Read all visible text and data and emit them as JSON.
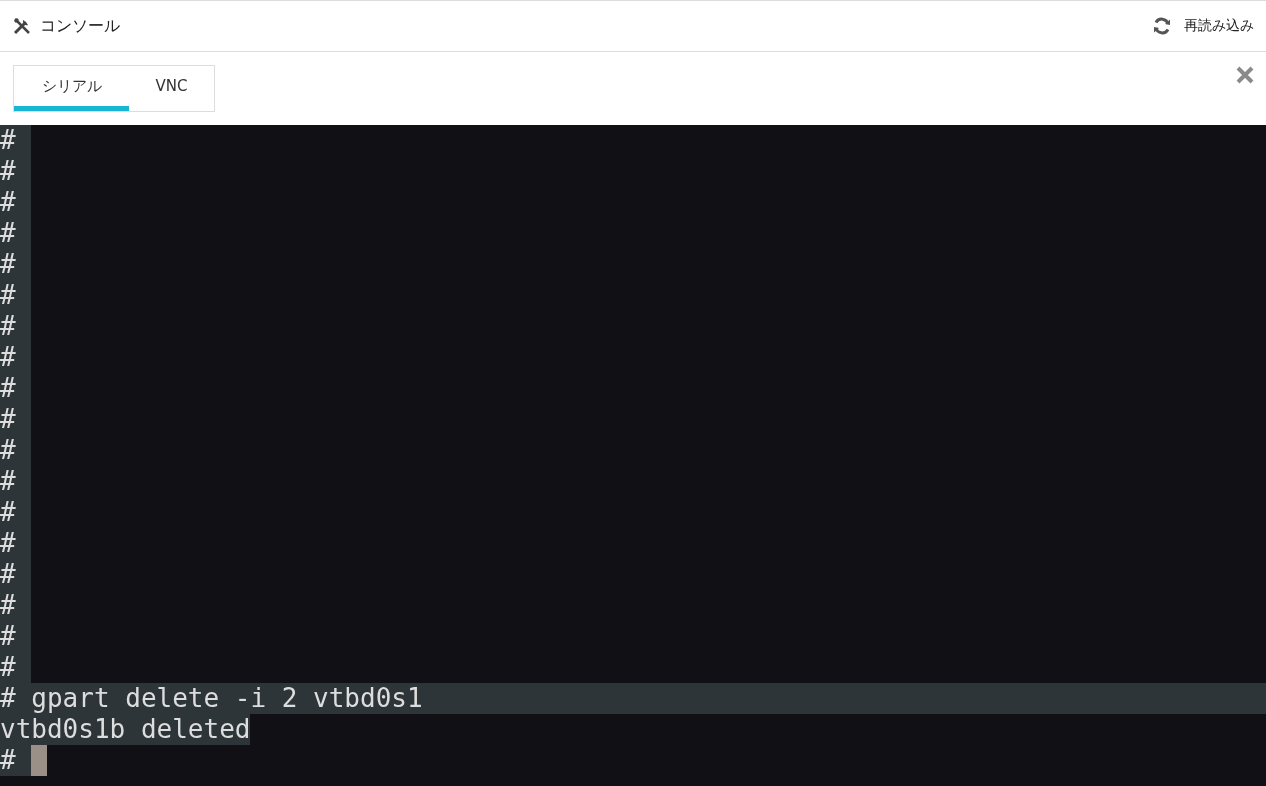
{
  "header": {
    "title": "コンソール",
    "reload": "再読み込み"
  },
  "tabs": [
    {
      "label": "シリアル",
      "selected": true
    },
    {
      "label": "VNC",
      "selected": false
    }
  ],
  "terminal": {
    "lines": [
      {
        "text": "# ",
        "kind": "text",
        "selected": true,
        "cursor": false
      },
      {
        "text": "# ",
        "kind": "text",
        "selected": true,
        "cursor": false
      },
      {
        "text": "# ",
        "kind": "text",
        "selected": true,
        "cursor": false
      },
      {
        "text": "# ",
        "kind": "text",
        "selected": true,
        "cursor": false
      },
      {
        "text": "# ",
        "kind": "text",
        "selected": true,
        "cursor": false
      },
      {
        "text": "# ",
        "kind": "text",
        "selected": true,
        "cursor": false
      },
      {
        "text": "# ",
        "kind": "text",
        "selected": true,
        "cursor": false
      },
      {
        "text": "# ",
        "kind": "text",
        "selected": true,
        "cursor": false
      },
      {
        "text": "# ",
        "kind": "text",
        "selected": true,
        "cursor": false
      },
      {
        "text": "# ",
        "kind": "text",
        "selected": true,
        "cursor": false
      },
      {
        "text": "# ",
        "kind": "text",
        "selected": true,
        "cursor": false
      },
      {
        "text": "# ",
        "kind": "text",
        "selected": true,
        "cursor": false
      },
      {
        "text": "# ",
        "kind": "text",
        "selected": true,
        "cursor": false
      },
      {
        "text": "# ",
        "kind": "text",
        "selected": true,
        "cursor": false
      },
      {
        "text": "# ",
        "kind": "text",
        "selected": true,
        "cursor": false
      },
      {
        "text": "# ",
        "kind": "text",
        "selected": true,
        "cursor": false
      },
      {
        "text": "# ",
        "kind": "text",
        "selected": true,
        "cursor": false
      },
      {
        "text": "# ",
        "kind": "text",
        "selected": true,
        "cursor": false
      },
      {
        "text": "# gpart delete -i 2 vtbd0s1",
        "kind": "row",
        "selected": true,
        "cursor": false
      },
      {
        "text": "vtbd0s1b deleted",
        "kind": "text",
        "selected": true,
        "cursor": false
      },
      {
        "text": "# ",
        "kind": "text",
        "selected": true,
        "cursor": true
      }
    ]
  }
}
